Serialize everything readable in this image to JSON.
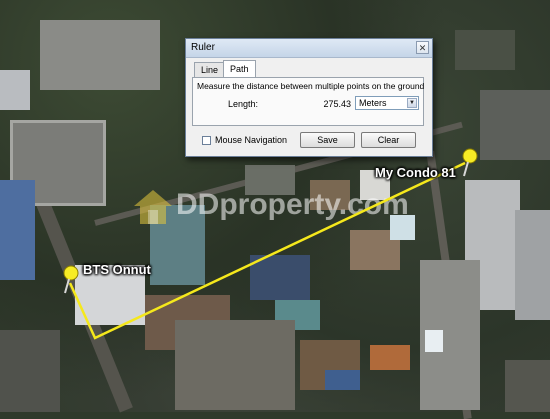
{
  "map": {
    "watermark_text": "DDproperty.com",
    "labels": {
      "condo": "My Condo 81",
      "station": "BTS Onnut"
    },
    "path_color": "#f5e81c",
    "pin_color": "#f7ec25"
  },
  "ruler": {
    "title": "Ruler",
    "close_symbol": "✕",
    "tabs": [
      {
        "label": "Line",
        "active": false
      },
      {
        "label": "Path",
        "active": true
      }
    ],
    "description": "Measure the distance between multiple points on the ground",
    "length_label": "Length:",
    "length_value": "275.43",
    "unit_selected": "Meters",
    "mouse_navigation_label": "Mouse Navigation",
    "mouse_navigation_checked": false,
    "save_label": "Save",
    "clear_label": "Clear"
  }
}
